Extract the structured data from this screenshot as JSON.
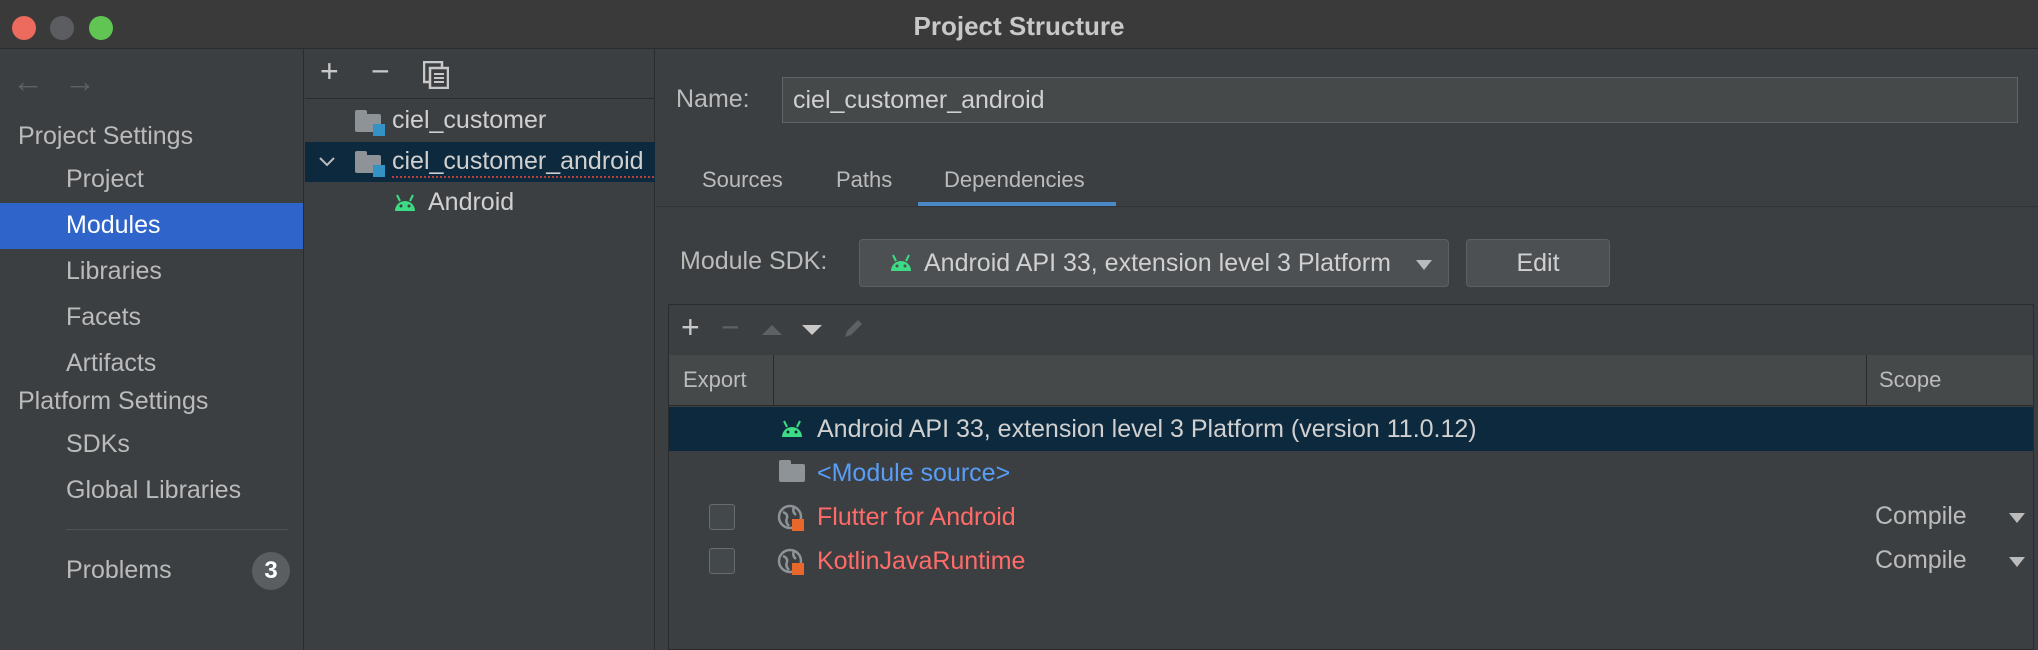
{
  "window": {
    "title": "Project Structure",
    "traffic_lights": {
      "close": "#ed6a5e",
      "minimize": "#5b5d60",
      "maximize": "#61c554"
    }
  },
  "sidebar": {
    "back_icon": "←",
    "forward_icon": "→",
    "sections": [
      {
        "label": "Project Settings",
        "items": [
          "Project",
          "Modules",
          "Libraries",
          "Facets",
          "Artifacts"
        ]
      },
      {
        "label": "Platform Settings",
        "items": [
          "SDKs",
          "Global Libraries"
        ]
      }
    ],
    "selected": "Modules",
    "problems": {
      "label": "Problems",
      "count": "3"
    }
  },
  "module_tree": {
    "toolbar": {
      "add": "+",
      "remove": "−"
    },
    "rows": [
      {
        "label": "ciel_customer",
        "icon": "module-folder-icon"
      },
      {
        "label": "ciel_customer_android",
        "icon": "module-folder-icon",
        "expanded": true,
        "selected": true
      },
      {
        "label": "Android",
        "icon": "android-icon"
      }
    ]
  },
  "module_detail": {
    "name_label": "Name:",
    "name_value": "ciel_customer_android",
    "tabs": [
      "Sources",
      "Paths",
      "Dependencies"
    ],
    "active_tab": "Dependencies",
    "sdk_label": "Module SDK:",
    "sdk_value": "Android API 33, extension level 3 Platform (version 11.0.12)",
    "edit_button": "Edit",
    "dependencies": {
      "toolbar": [
        "add",
        "remove",
        "move-up",
        "move-down",
        "edit"
      ],
      "header": {
        "export": "Export",
        "scope": "Scope"
      },
      "rows": [
        {
          "label": "Android API 33, extension level 3 Platform (version 11.0.12)",
          "icon": "android-icon",
          "color": "#d0d0d0",
          "selected": true
        },
        {
          "label": "<Module source>",
          "icon": "folder-icon",
          "color": "#589df6"
        },
        {
          "label": "Flutter for Android",
          "icon": "library-globe-icon",
          "color": "#ff6b68",
          "scope": "Compile",
          "export": false
        },
        {
          "label": "KotlinJavaRuntime",
          "icon": "library-globe-icon",
          "color": "#ff6b68",
          "scope": "Compile",
          "export": false
        }
      ]
    }
  },
  "colors": {
    "selection": "#2f65ca",
    "row_selection": "#0d293e",
    "error_text": "#ff6b68",
    "link_text": "#589df6",
    "android_green": "#3ddc84",
    "tab_underline": "#4a88c7"
  }
}
